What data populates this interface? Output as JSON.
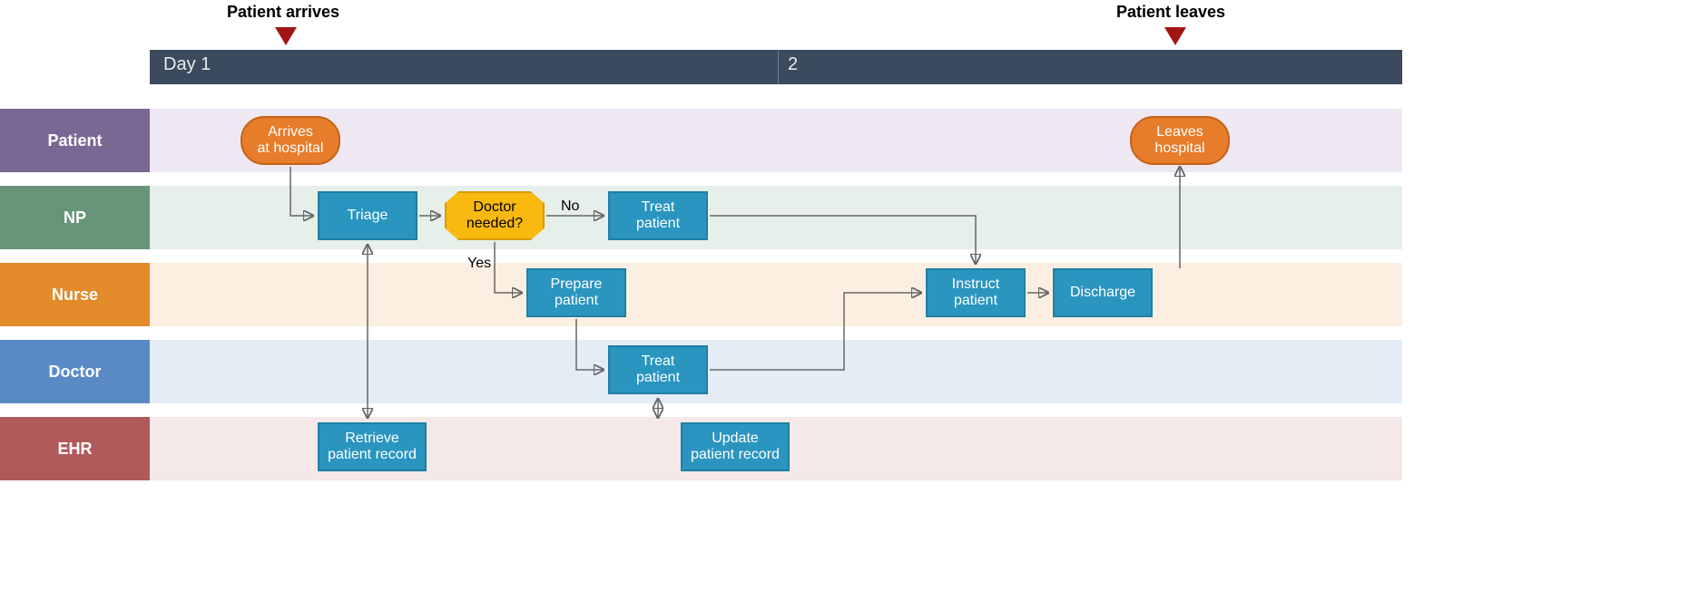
{
  "timeline": {
    "segments": [
      "Day 1",
      "2"
    ],
    "milestones": [
      {
        "id": "arrive",
        "label": "Patient arrives"
      },
      {
        "id": "leave",
        "label": "Patient leaves"
      }
    ]
  },
  "lanes": [
    {
      "id": "patient",
      "label": "Patient"
    },
    {
      "id": "np",
      "label": "NP"
    },
    {
      "id": "nurse",
      "label": "Nurse"
    },
    {
      "id": "doctor",
      "label": "Doctor"
    },
    {
      "id": "ehr",
      "label": "EHR"
    }
  ],
  "nodes": {
    "arrives": {
      "label": "Arrives\nat hospital",
      "lane": "patient",
      "type": "terminator"
    },
    "triage": {
      "label": "Triage",
      "lane": "np",
      "type": "process"
    },
    "doctor_needed": {
      "label": "Doctor\nneeded?",
      "lane": "np",
      "type": "decision"
    },
    "treat_np": {
      "label": "Treat\npatient",
      "lane": "np",
      "type": "process"
    },
    "prepare": {
      "label": "Prepare\npatient",
      "lane": "nurse",
      "type": "process"
    },
    "instruct": {
      "label": "Instruct\npatient",
      "lane": "nurse",
      "type": "process"
    },
    "discharge": {
      "label": "Discharge",
      "lane": "nurse",
      "type": "process"
    },
    "treat_doc": {
      "label": "Treat\npatient",
      "lane": "doctor",
      "type": "process"
    },
    "retrieve": {
      "label": "Retrieve\npatient record",
      "lane": "ehr",
      "type": "process"
    },
    "update": {
      "label": "Update\npatient record",
      "lane": "ehr",
      "type": "process"
    },
    "leaves": {
      "label": "Leaves\nhospital",
      "lane": "patient",
      "type": "terminator"
    }
  },
  "edges": [
    {
      "from": "arrives",
      "to": "triage"
    },
    {
      "from": "triage",
      "to": "doctor_needed"
    },
    {
      "from": "doctor_needed",
      "to": "treat_np",
      "label": "No"
    },
    {
      "from": "doctor_needed",
      "to": "prepare",
      "label": "Yes"
    },
    {
      "from": "prepare",
      "to": "treat_doc"
    },
    {
      "from": "treat_np",
      "to": "instruct"
    },
    {
      "from": "treat_doc",
      "to": "instruct"
    },
    {
      "from": "instruct",
      "to": "discharge"
    },
    {
      "from": "discharge",
      "to": "leaves"
    },
    {
      "from": "retrieve",
      "to": "triage",
      "bidirectional": true
    },
    {
      "from": "update",
      "to": "treat_doc",
      "bidirectional": true
    }
  ]
}
